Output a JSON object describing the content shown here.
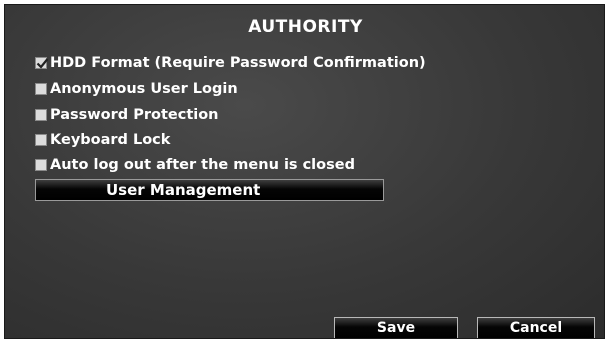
{
  "dialog": {
    "title": "AUTHORITY"
  },
  "options": [
    {
      "label": "HDD Format (Require Password Confirmation)",
      "checked": true
    },
    {
      "label": "Anonymous User Login",
      "checked": false
    },
    {
      "label": "Password Protection",
      "checked": false
    },
    {
      "label": "Keyboard Lock",
      "checked": false
    },
    {
      "label": "Auto log out after the menu is closed",
      "checked": false
    }
  ],
  "user_management": {
    "label": "User Management"
  },
  "footer": {
    "save_label": "Save",
    "cancel_label": "Cancel"
  },
  "colors": {
    "panel_background": "#3a3a3a",
    "text": "#ffffff",
    "checkbox_fill": "#dcdcdc"
  },
  "icons": {
    "check": "check-mark-icon"
  }
}
